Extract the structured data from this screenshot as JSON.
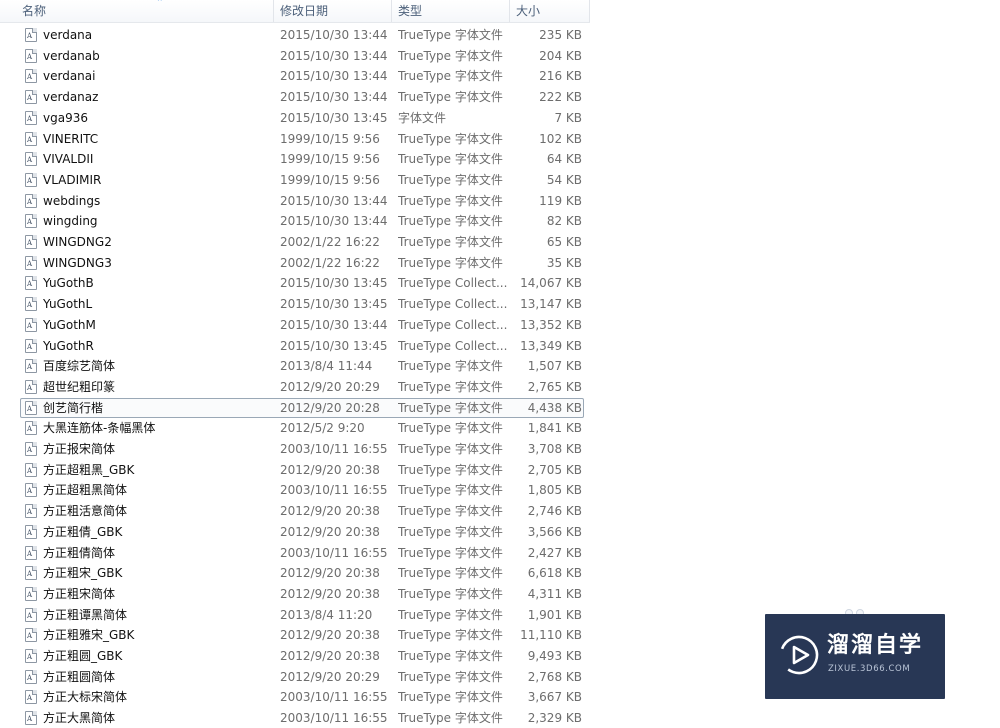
{
  "header": {
    "name": "名称",
    "date": "修改日期",
    "type": "类型",
    "size": "大小"
  },
  "files": [
    {
      "name": "verdana",
      "date": "2015/10/30 13:44",
      "type": "TrueType 字体文件",
      "size": "235 KB"
    },
    {
      "name": "verdanab",
      "date": "2015/10/30 13:44",
      "type": "TrueType 字体文件",
      "size": "204 KB"
    },
    {
      "name": "verdanai",
      "date": "2015/10/30 13:44",
      "type": "TrueType 字体文件",
      "size": "216 KB"
    },
    {
      "name": "verdanaz",
      "date": "2015/10/30 13:44",
      "type": "TrueType 字体文件",
      "size": "222 KB"
    },
    {
      "name": "vga936",
      "date": "2015/10/30 13:45",
      "type": "字体文件",
      "size": "7 KB"
    },
    {
      "name": "VINERITC",
      "date": "1999/10/15 9:56",
      "type": "TrueType 字体文件",
      "size": "102 KB"
    },
    {
      "name": "VIVALDII",
      "date": "1999/10/15 9:56",
      "type": "TrueType 字体文件",
      "size": "64 KB"
    },
    {
      "name": "VLADIMIR",
      "date": "1999/10/15 9:56",
      "type": "TrueType 字体文件",
      "size": "54 KB"
    },
    {
      "name": "webdings",
      "date": "2015/10/30 13:44",
      "type": "TrueType 字体文件",
      "size": "119 KB"
    },
    {
      "name": "wingding",
      "date": "2015/10/30 13:44",
      "type": "TrueType 字体文件",
      "size": "82 KB"
    },
    {
      "name": "WINGDNG2",
      "date": "2002/1/22 16:22",
      "type": "TrueType 字体文件",
      "size": "65 KB"
    },
    {
      "name": "WINGDNG3",
      "date": "2002/1/22 16:22",
      "type": "TrueType 字体文件",
      "size": "35 KB"
    },
    {
      "name": "YuGothB",
      "date": "2015/10/30 13:45",
      "type": "TrueType Collect...",
      "size": "14,067 KB"
    },
    {
      "name": "YuGothL",
      "date": "2015/10/30 13:45",
      "type": "TrueType Collect...",
      "size": "13,147 KB"
    },
    {
      "name": "YuGothM",
      "date": "2015/10/30 13:44",
      "type": "TrueType Collect...",
      "size": "13,352 KB"
    },
    {
      "name": "YuGothR",
      "date": "2015/10/30 13:45",
      "type": "TrueType Collect...",
      "size": "13,349 KB"
    },
    {
      "name": "百度综艺简体",
      "date": "2013/8/4 11:44",
      "type": "TrueType 字体文件",
      "size": "1,507 KB"
    },
    {
      "name": "超世纪粗印篆",
      "date": "2012/9/20 20:29",
      "type": "TrueType 字体文件",
      "size": "2,765 KB"
    },
    {
      "name": "创艺简行楷",
      "date": "2012/9/20 20:28",
      "type": "TrueType 字体文件",
      "size": "4,438 KB"
    },
    {
      "name": "大黑连筋体-条幅黑体",
      "date": "2012/5/2 9:20",
      "type": "TrueType 字体文件",
      "size": "1,841 KB"
    },
    {
      "name": "方正报宋简体",
      "date": "2003/10/11 16:55",
      "type": "TrueType 字体文件",
      "size": "3,708 KB"
    },
    {
      "name": "方正超粗黑_GBK",
      "date": "2012/9/20 20:38",
      "type": "TrueType 字体文件",
      "size": "2,705 KB"
    },
    {
      "name": "方正超粗黑简体",
      "date": "2003/10/11 16:55",
      "type": "TrueType 字体文件",
      "size": "1,805 KB"
    },
    {
      "name": "方正粗活意简体",
      "date": "2012/9/20 20:38",
      "type": "TrueType 字体文件",
      "size": "2,746 KB"
    },
    {
      "name": "方正粗倩_GBK",
      "date": "2012/9/20 20:38",
      "type": "TrueType 字体文件",
      "size": "3,566 KB"
    },
    {
      "name": "方正粗倩简体",
      "date": "2003/10/11 16:55",
      "type": "TrueType 字体文件",
      "size": "2,427 KB"
    },
    {
      "name": "方正粗宋_GBK",
      "date": "2012/9/20 20:38",
      "type": "TrueType 字体文件",
      "size": "6,618 KB"
    },
    {
      "name": "方正粗宋简体",
      "date": "2012/9/20 20:38",
      "type": "TrueType 字体文件",
      "size": "4,311 KB"
    },
    {
      "name": "方正粗谭黑简体",
      "date": "2013/8/4 11:20",
      "type": "TrueType 字体文件",
      "size": "1,901 KB"
    },
    {
      "name": "方正粗雅宋_GBK",
      "date": "2012/9/20 20:38",
      "type": "TrueType 字体文件",
      "size": "11,110 KB"
    },
    {
      "name": "方正粗圆_GBK",
      "date": "2012/9/20 20:38",
      "type": "TrueType 字体文件",
      "size": "9,493 KB"
    },
    {
      "name": "方正粗圆简体",
      "date": "2012/9/20 20:29",
      "type": "TrueType 字体文件",
      "size": "2,768 KB"
    },
    {
      "name": "方正大标宋简体",
      "date": "2003/10/11 16:55",
      "type": "TrueType 字体文件",
      "size": "3,667 KB"
    },
    {
      "name": "方正大黑简体",
      "date": "2003/10/11 16:55",
      "type": "TrueType 字体文件",
      "size": "2,329 KB"
    }
  ],
  "focused_index": 18,
  "watermark": {
    "title": "溜溜自学",
    "url": "ZIXUE.3D66.COM"
  },
  "colors": {
    "watermark_bg": "#283755",
    "header_text": "#4c607a",
    "focus_border": "#9aa8b6"
  },
  "icons": {
    "file": "font-file-icon",
    "logo": "play-logo-icon"
  }
}
